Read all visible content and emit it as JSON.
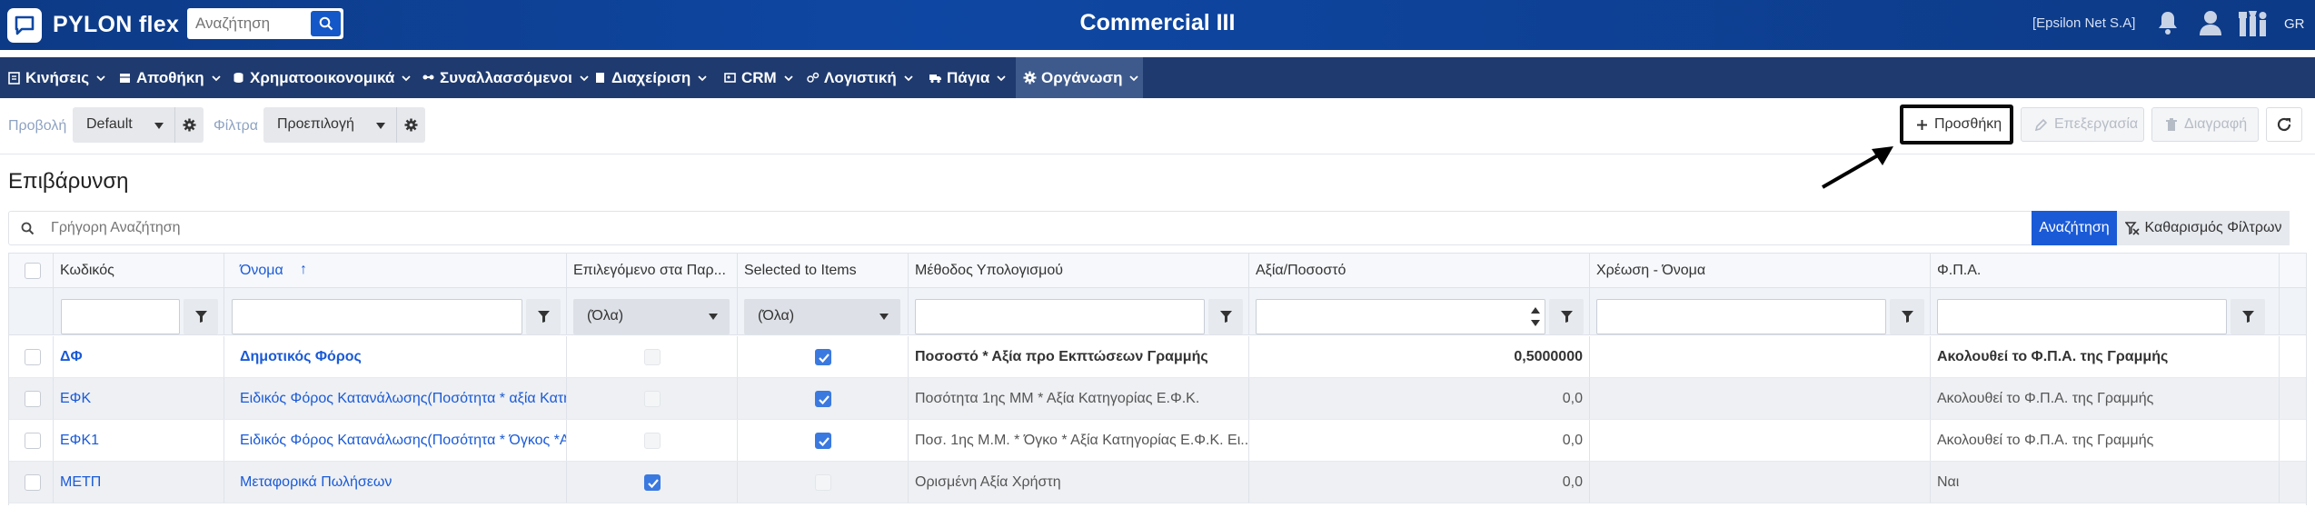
{
  "topbar": {
    "brand": "PYLON flex",
    "search_placeholder": "Αναζήτηση",
    "app_title": "Commercial III",
    "company": "[Epsilon Net S.A]",
    "lang": "GR"
  },
  "menu": {
    "items": [
      {
        "label": "Κινήσεις",
        "icon": "moves-icon"
      },
      {
        "label": "Αποθήκη",
        "icon": "warehouse-icon"
      },
      {
        "label": "Χρηματοοικονομικά",
        "icon": "finance-icon"
      },
      {
        "label": "Συναλλασσόμενοι",
        "icon": "contacts-icon"
      },
      {
        "label": "Διαχείριση",
        "icon": "management-icon"
      },
      {
        "label": "CRM",
        "icon": "crm-icon"
      },
      {
        "label": "Λογιστική",
        "icon": "accounting-icon"
      },
      {
        "label": "Πάγια",
        "icon": "truck-icon"
      },
      {
        "label": "Οργάνωση",
        "icon": "gear-icon"
      }
    ]
  },
  "toolbar": {
    "view_label": "Προβολή",
    "view_value": "Default",
    "filter_label": "Φίλτρα",
    "filter_value": "Προεπιλογή",
    "add_label": "Προσθήκη",
    "edit_label": "Επεξεργασία",
    "delete_label": "Διαγραφή"
  },
  "page": {
    "title": "Επιβάρυνση"
  },
  "quick_search": {
    "placeholder": "Γρήγορη Αναζήτηση",
    "search_label": "Αναζήτηση",
    "clear_label": "Καθαρισμός Φίλτρων"
  },
  "grid": {
    "columns": [
      "Κωδικός",
      "Όνομα",
      "Επιλεγόμενο στα Παρ...",
      "Selected to Items",
      "Μέθοδος Υπολογισμού",
      "Αξία/Ποσοστό",
      "Χρέωση - Όνομα",
      "Φ.Π.Α."
    ],
    "sort_arrow": "↑",
    "filter_all": "(Όλα)",
    "rows": [
      {
        "code": "ΔΦ",
        "name": "Δημοτικός Φόρος",
        "selected_docs": false,
        "selected_items": true,
        "method": "Ποσοστό * Αξία προ Εκπτώσεων Γραμμής",
        "value": "0,5000000",
        "charge_name": "",
        "vat": "Ακολουθεί το Φ.Π.Α. της Γραμμής"
      },
      {
        "code": "ΕΦΚ",
        "name": "Ειδικός Φόρος Κατανάλωσης(Ποσότητα * αξία Κατηγ",
        "selected_docs": false,
        "selected_items": true,
        "method": "Ποσότητα 1ης ΜΜ * Αξία Κατηγορίας Ε.Φ.Κ.",
        "value": "0,0",
        "charge_name": "",
        "vat": "Ακολουθεί το Φ.Π.Α. της Γραμμής"
      },
      {
        "code": "ΕΦΚ1",
        "name": "Ειδικός Φόρος Κατανάλωσης(Ποσότητα * Όγκος *Αξ",
        "selected_docs": false,
        "selected_items": true,
        "method": "Ποσ. 1ης Μ.Μ. * Όγκο * Αξία Κατηγορίας Ε.Φ.Κ. Ει...",
        "value": "0,0",
        "charge_name": "",
        "vat": "Ακολουθεί το Φ.Π.Α. της Γραμμής"
      },
      {
        "code": "ΜΕΤΠ",
        "name": "Μεταφορικά Πωλήσεων",
        "selected_docs": true,
        "selected_items": false,
        "method": "Ορισμένη Αξία Χρήστη",
        "value": "0,0",
        "charge_name": "",
        "vat": "Ναι"
      }
    ]
  },
  "colors": {
    "topbar": "#0e47a3",
    "menubar": "#1f3a6e",
    "accent": "#1a5ad7"
  }
}
